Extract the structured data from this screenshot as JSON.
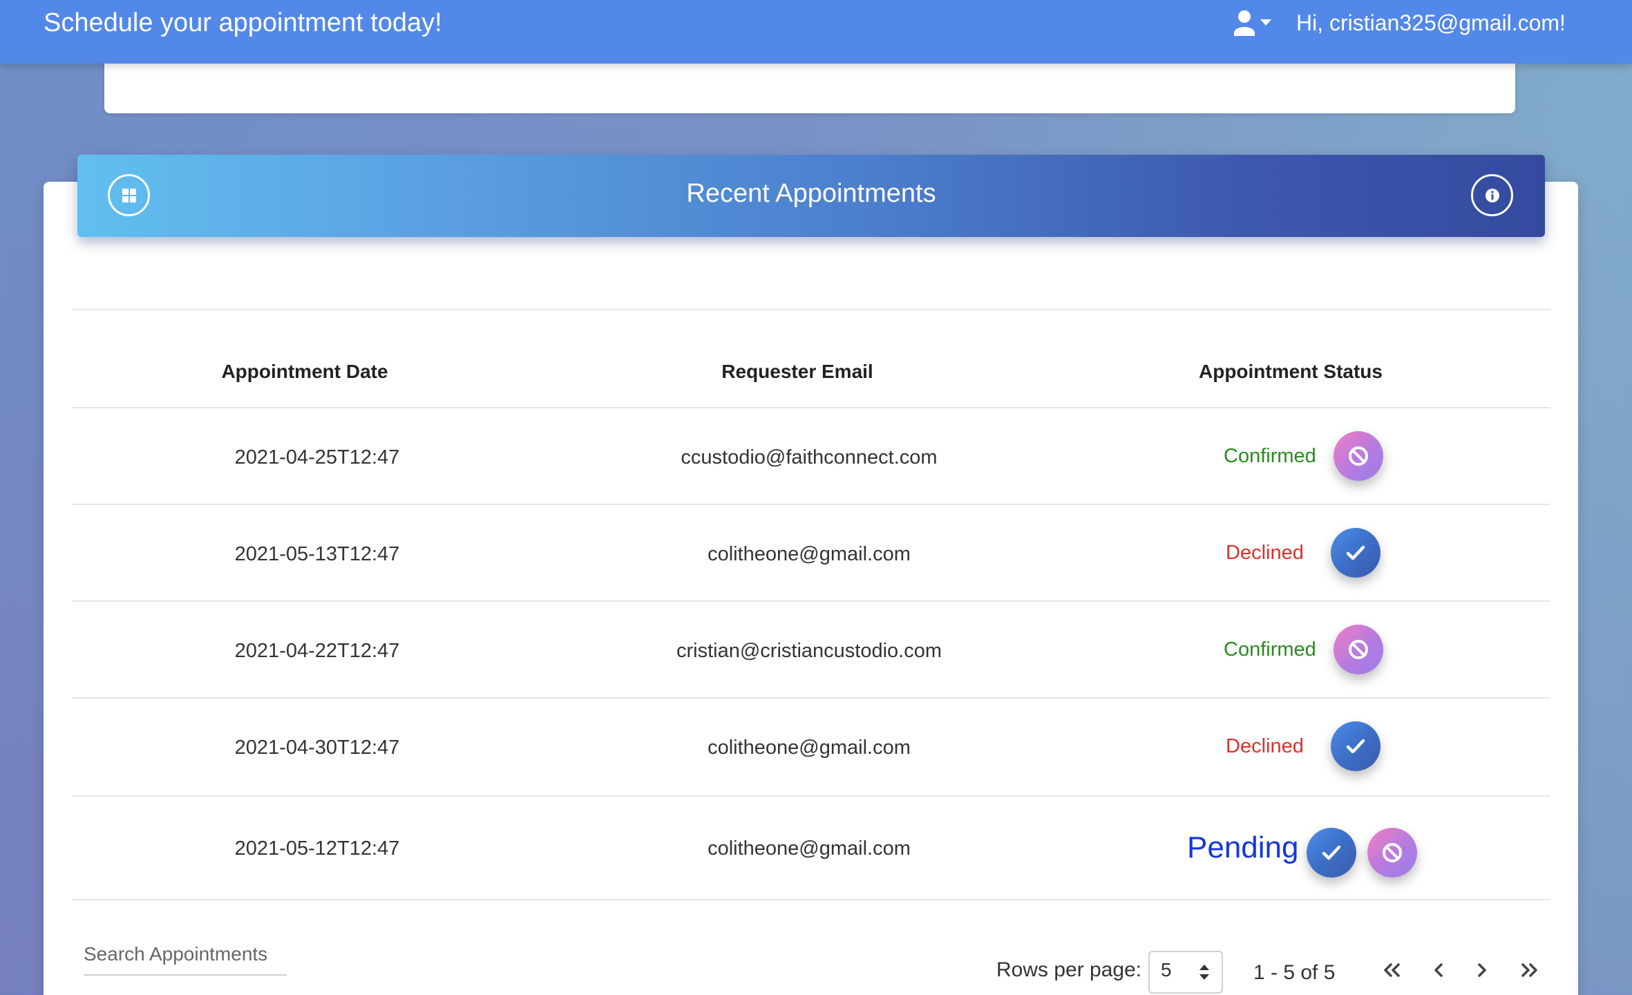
{
  "navbar": {
    "title": "Schedule your appointment today!",
    "greeting": "Hi, cristian325@gmail.com!",
    "user_icon": "user-icon"
  },
  "card": {
    "title": "Recent Appointments",
    "left_icon": "grid-icon",
    "right_icon": "info-icon"
  },
  "table": {
    "headers": {
      "date": "Appointment Date",
      "email": "Requester Email",
      "status": "Appointment Status"
    },
    "rows": [
      {
        "date": "2021-04-25T12:47",
        "email": "ccustodio@faithconnect.com",
        "status": "Confirmed",
        "actions": [
          "decline"
        ]
      },
      {
        "date": "2021-05-13T12:47",
        "email": "colitheone@gmail.com",
        "status": "Declined",
        "actions": [
          "confirm"
        ]
      },
      {
        "date": "2021-04-22T12:47",
        "email": "cristian@cristiancustodio.com",
        "status": "Confirmed",
        "actions": [
          "decline"
        ]
      },
      {
        "date": "2021-04-30T12:47",
        "email": "colitheone@gmail.com",
        "status": "Declined",
        "actions": [
          "confirm"
        ]
      },
      {
        "date": "2021-05-12T12:47",
        "email": "colitheone@gmail.com",
        "status": "Pending",
        "actions": [
          "confirm",
          "decline"
        ]
      }
    ]
  },
  "footer": {
    "search_placeholder": "Search Appointments",
    "rows_per_page_label": "Rows per page:",
    "rows_per_page_value": "5",
    "range_text": "1 - 5 of 5"
  },
  "colors": {
    "navbar": "#5288e8",
    "confirmed": "#2a8a1e",
    "declined": "#e0302a",
    "pending": "#1436e0"
  }
}
